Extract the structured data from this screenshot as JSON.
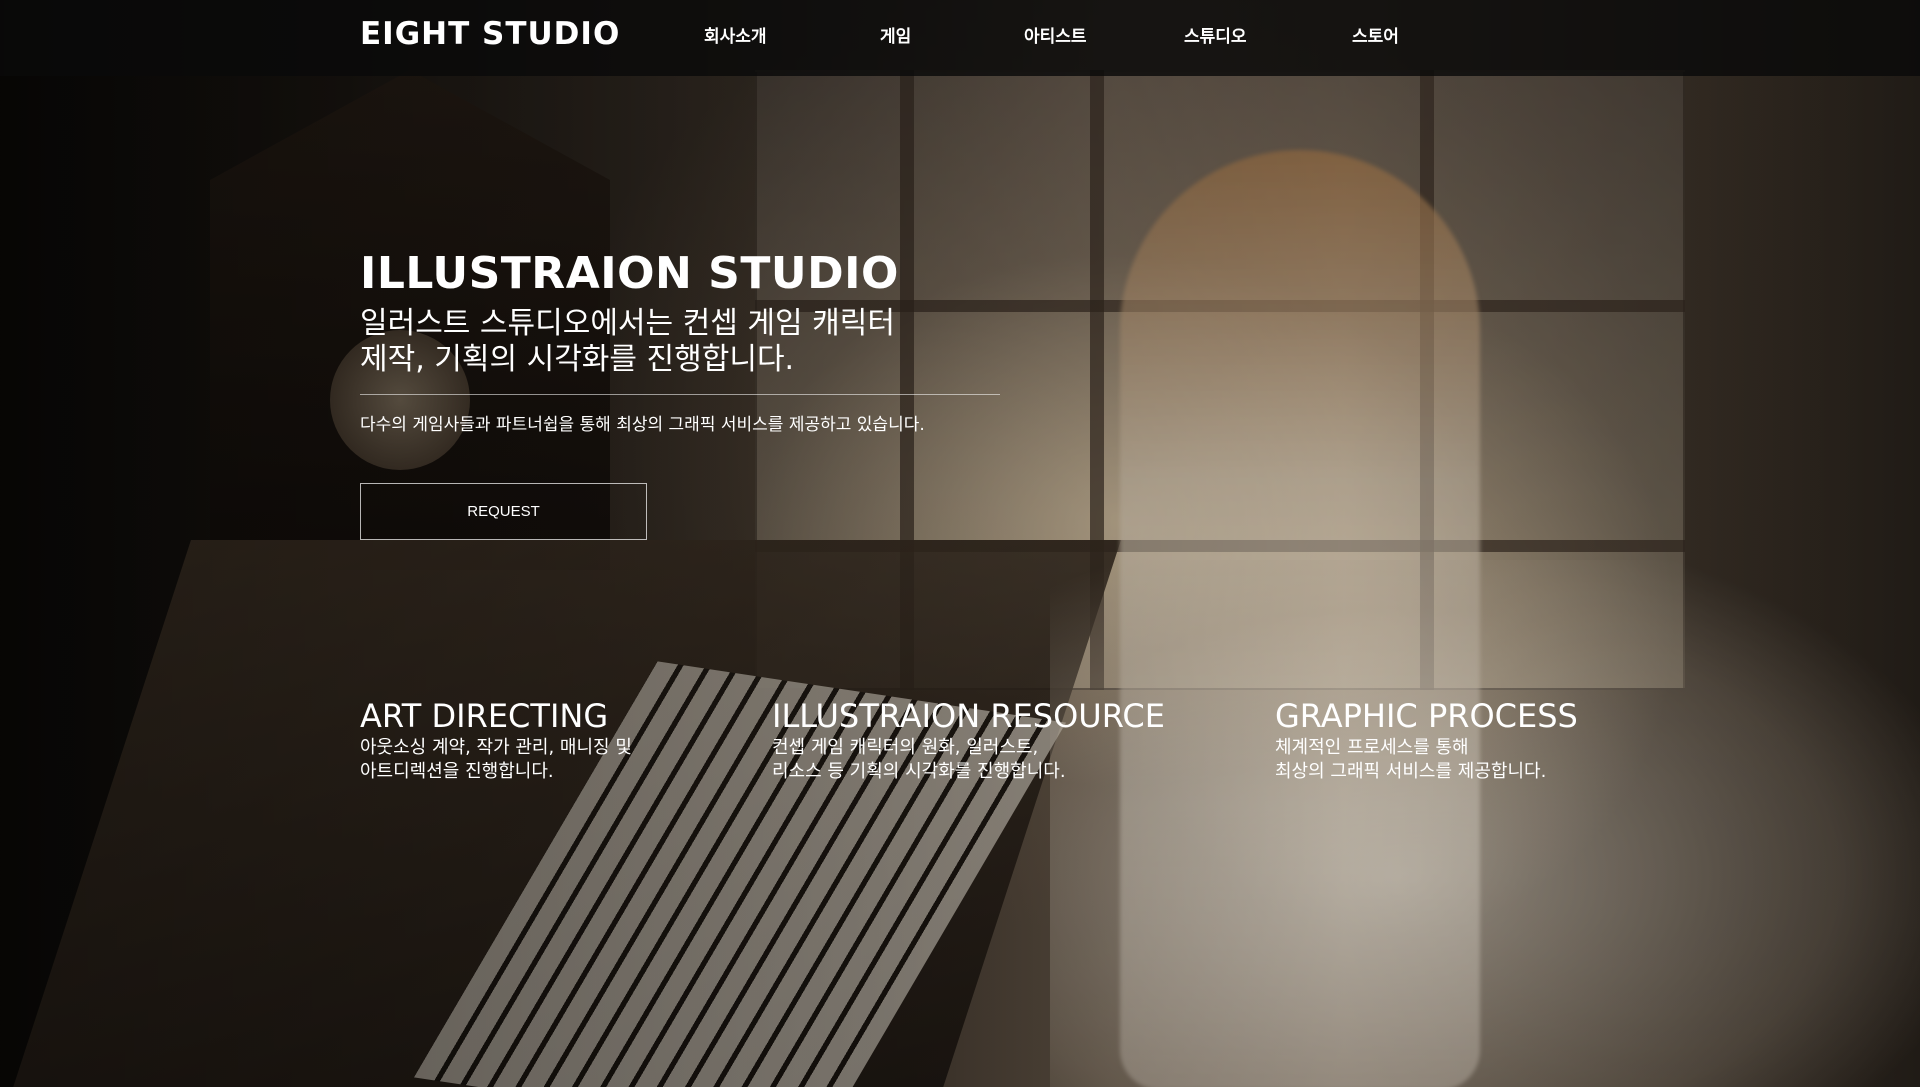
{
  "header": {
    "logo": "EIGHT STUDIO",
    "nav": [
      "회사소개",
      "게임",
      "아티스트",
      "스튜디오",
      "스토어"
    ]
  },
  "hero": {
    "title": "ILLUSTRAION STUDIO",
    "subtitle_line1": "일러스트 스튜디오에서는 컨셉 게임 캐릭터",
    "subtitle_line2": "제작, 기획의 시각화를 진행합니다.",
    "description": "다수의 게임사들과 파트너쉽을 통해 최상의 그래픽 서비스를 제공하고 있습니다.",
    "button": "REQUEST"
  },
  "features": [
    {
      "title": "ART DIRECTING",
      "line1": "아웃소싱 계약, 작가 관리, 매니징 및",
      "line2": "아트디렉션을 진행합니다."
    },
    {
      "title": "ILLUSTRAION RESOURCE",
      "line1": "컨셉 게임 캐릭터의 원화, 일러스트,",
      "line2": "리소스 등 기획의 시각화를 진행합니다."
    },
    {
      "title": "GRAPHIC PROCESS",
      "line1": "체계적인 프로세스를 통해",
      "line2": "최상의 그래픽 서비스를 제공합니다."
    }
  ]
}
